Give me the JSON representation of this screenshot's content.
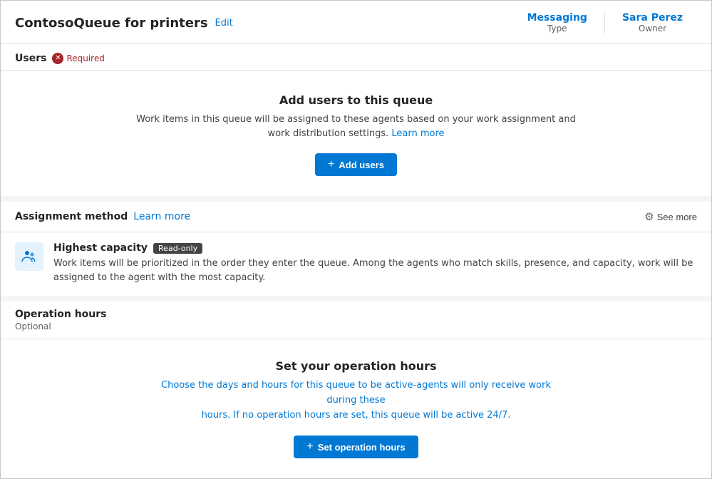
{
  "header": {
    "title": "ContosoQueue for printers",
    "edit_label": "Edit",
    "meta_type_label": "Type",
    "meta_type_value": "Messaging",
    "meta_owner_label": "Owner",
    "meta_owner_value": "Sara Perez"
  },
  "users_section": {
    "title": "Users",
    "required_label": "Required",
    "card": {
      "title": "Add users to this queue",
      "description": "Work items in this queue will be assigned to these agents based on your work assignment and work distribution settings.",
      "learn_more_label": "Learn more",
      "add_button_label": "Add users"
    }
  },
  "assignment_section": {
    "title": "Assignment method",
    "learn_more_label": "Learn more",
    "see_more_label": "See more",
    "method": {
      "name": "Highest capacity",
      "badge": "Read-only",
      "description": "Work items will be prioritized in the order they enter the queue. Among the agents who match skills, presence, and capacity, work will be assigned to the agent with the most capacity."
    }
  },
  "operation_hours_section": {
    "title": "Operation hours",
    "optional_label": "Optional",
    "card": {
      "title": "Set your operation hours",
      "description_line1": "Choose the days and hours for this queue to be active-agents will only receive work during these",
      "description_line2": "hours. If no operation hours are set, this queue will be active 24/7.",
      "set_button_label": "Set operation hours"
    }
  },
  "icons": {
    "add": "+",
    "gear": "⚙",
    "required_x": "✕"
  }
}
